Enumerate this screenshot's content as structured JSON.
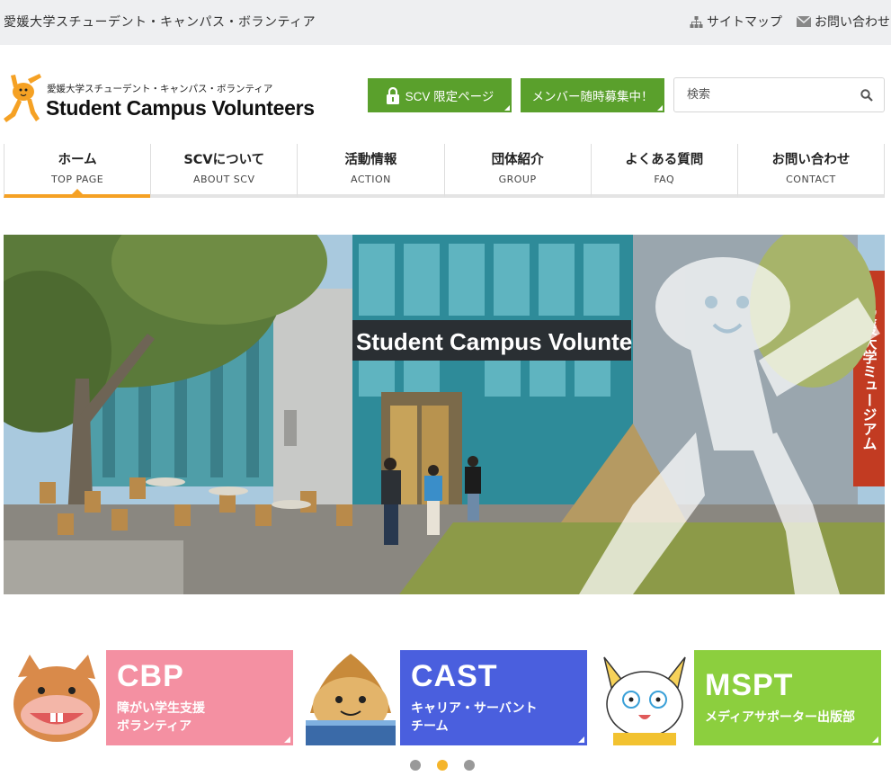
{
  "topbar": {
    "org_name": "愛媛大学スチューデント・キャンパス・ボランティア",
    "sitemap_label": "サイトマップ",
    "contact_label": "お問い合わせ"
  },
  "logo": {
    "subtitle": "愛媛大学スチューデント・キャンパス・ボランティア",
    "title": "Student Campus Volunteers"
  },
  "header": {
    "limited_button": "SCV 限定ページ",
    "recruit_button": "メンバー随時募集中！",
    "search_placeholder": "検索"
  },
  "nav": {
    "items": [
      {
        "jp": "ホーム",
        "en": "TOP PAGE"
      },
      {
        "jp": "SCVについて",
        "en": "ABOUT SCV"
      },
      {
        "jp": "活動情報",
        "en": "ACTION"
      },
      {
        "jp": "団体紹介",
        "en": "GROUP"
      },
      {
        "jp": "よくある質問",
        "en": "FAQ"
      },
      {
        "jp": "お問い合わせ",
        "en": "CONTACT"
      }
    ],
    "active_index": 0
  },
  "hero": {
    "sign_text": "Student Campus Volunteers",
    "vertical_sign": "愛媛大学ミュージアム"
  },
  "banners": [
    {
      "title": "CBP",
      "desc_line1": "障がい学生支援",
      "desc_line2": "ボランティア",
      "color": "#f490a2"
    },
    {
      "title": "CAST",
      "desc_line1": "キャリア・サーバント",
      "desc_line2": "チーム",
      "color": "#4a5fde"
    },
    {
      "title": "MSPT",
      "desc_line1": "メディアサポーター出版部",
      "desc_line2": "",
      "color": "#8ccf3e"
    }
  ],
  "carousel": {
    "active_dot": 1
  },
  "colors": {
    "accent_orange": "#f5a124",
    "button_green": "#5aa02c",
    "dot_active": "#f5b52b"
  }
}
